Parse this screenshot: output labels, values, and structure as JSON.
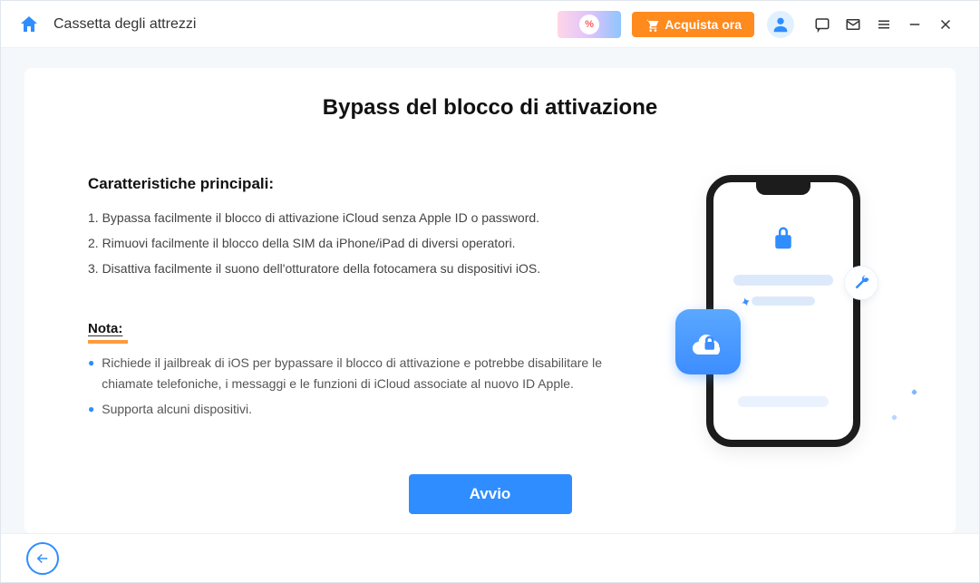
{
  "header": {
    "title": "Cassetta degli attrezzi",
    "promo_percent": "%",
    "buy_label": "Acquista ora"
  },
  "page": {
    "title": "Bypass del blocco di attivazione"
  },
  "features": {
    "heading": "Caratteristiche principali:",
    "items": [
      "1. Bypassa facilmente il blocco di attivazione iCloud senza Apple ID o password.",
      "2. Rimuovi facilmente il blocco della SIM da iPhone/iPad di diversi operatori.",
      "3. Disattiva facilmente il suono dell'otturatore della fotocamera su dispositivi iOS."
    ]
  },
  "notes": {
    "heading": "Nota:",
    "items": [
      "Richiede il jailbreak di iOS per bypassare il blocco di attivazione e potrebbe disabilitare le chiamate telefoniche, i messaggi e le funzioni di iCloud associate al nuovo ID Apple.",
      "Supporta alcuni dispositivi."
    ]
  },
  "actions": {
    "start": "Avvio"
  }
}
